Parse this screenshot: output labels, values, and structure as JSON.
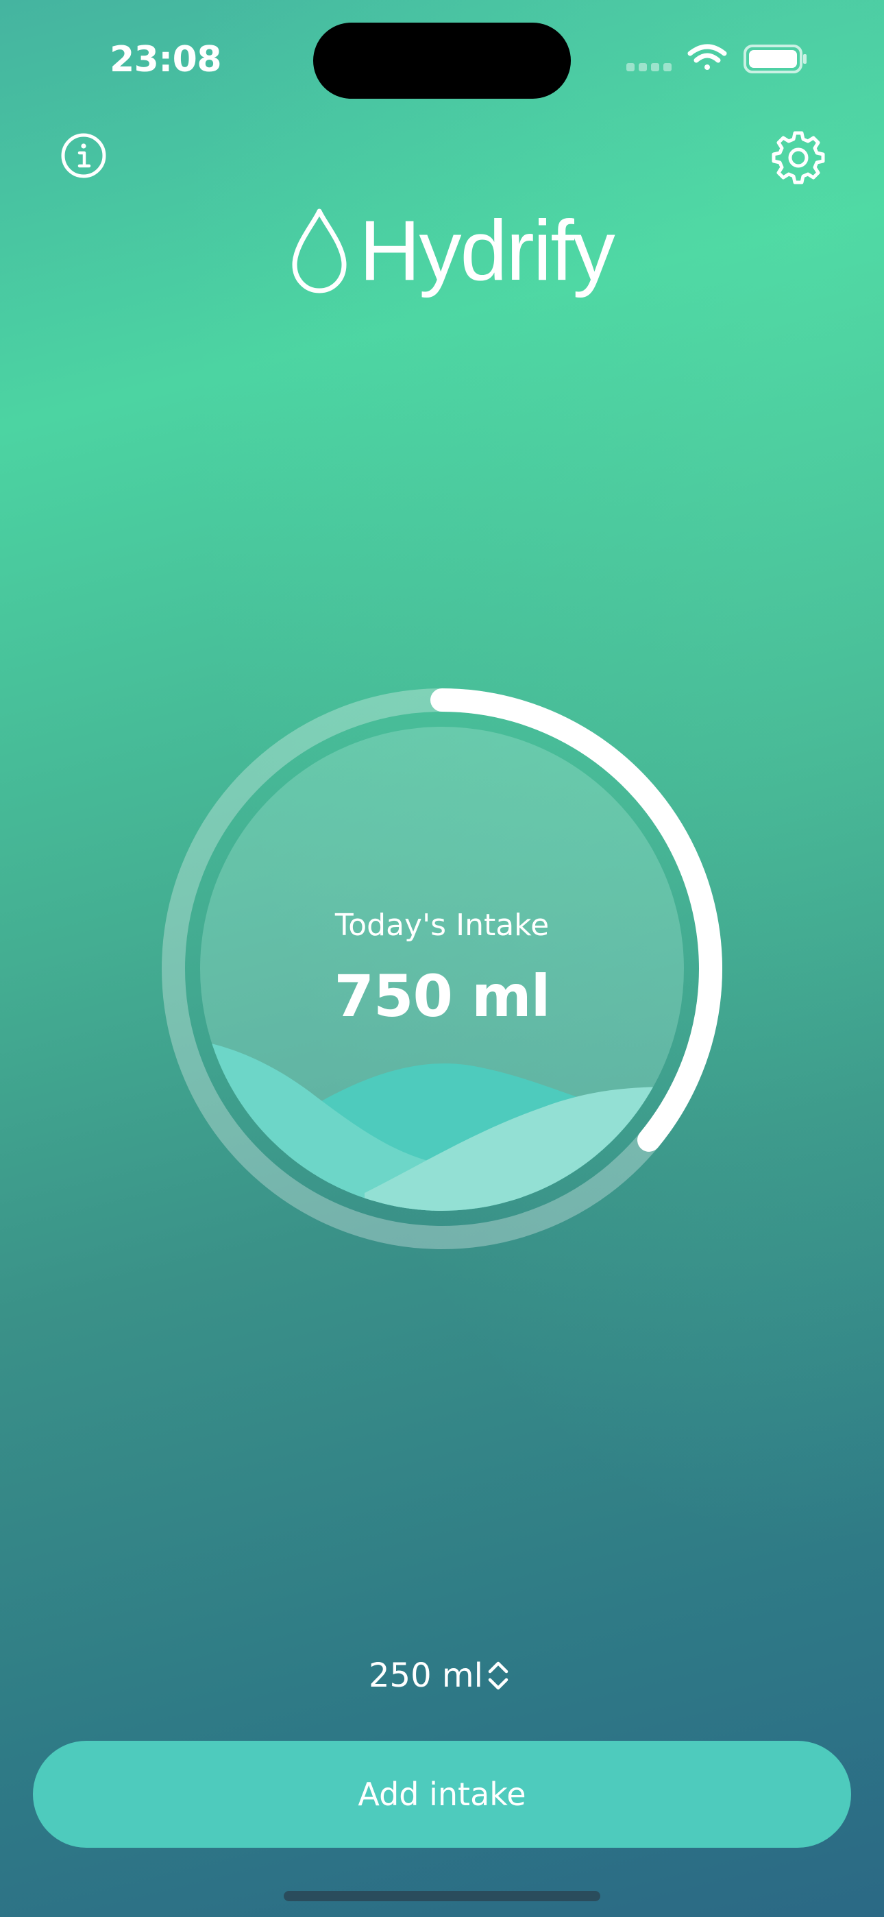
{
  "status_bar": {
    "time": "23:08"
  },
  "header": {
    "app_name": "Hydrify",
    "info_icon": "info-circle-icon",
    "settings_icon": "gear-icon",
    "logo_icon": "water-drop-icon"
  },
  "intake": {
    "label": "Today's Intake",
    "value": "750 ml",
    "progress_fraction": 0.36
  },
  "amount_selector": {
    "value": "250 ml",
    "icon": "chevron-up-down-icon"
  },
  "actions": {
    "add_label": "Add intake"
  },
  "colors": {
    "accent": "#4ecbbd",
    "wave_light": "#93e0d4",
    "wave_mid": "#6dd6c8",
    "wave_dark": "#4ecbbd"
  }
}
